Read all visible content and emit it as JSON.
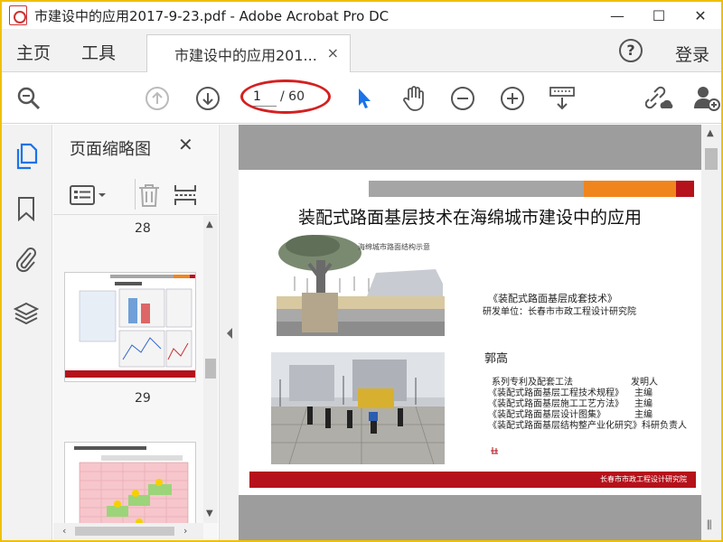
{
  "window": {
    "title": "市建设中的应用2017-9-23.pdf - Adobe Acrobat Pro DC",
    "controls": [
      "—",
      "☐",
      "✕"
    ]
  },
  "nav": {
    "home": "主页",
    "tools": "工具",
    "doc_tab": "市建设中的应用201...",
    "doc_tab_close": "×",
    "help": "?",
    "login": "登录"
  },
  "toolbar": {
    "page_current": "1",
    "page_total": "/ 60",
    "icons": [
      "search-icon",
      "page-up-icon",
      "page-down-icon",
      "select-arrow-icon",
      "hand-icon",
      "zoom-out-icon",
      "zoom-in-icon",
      "keyboard-scroll-icon",
      "link-cloud-icon",
      "add-user-icon"
    ]
  },
  "sidebar": {
    "icons": [
      "page-thumbnails-icon",
      "bookmark-icon",
      "attachment-icon",
      "layers-icon"
    ]
  },
  "thumbnails": {
    "title": "页面缩略图",
    "close": "✕",
    "pages": [
      {
        "label": "28"
      },
      {
        "label": "29"
      }
    ]
  },
  "slide": {
    "title": "装配式路面基层技术在海绵城市建设中的应用",
    "book": "《装配式路面基层成套技术》",
    "unit": "研发单位：长春市市政工程设计研究院",
    "author": "郭高",
    "lines": [
      "系列专利及配套工法",
      "《装配式路面基层工程技术规程》",
      "《装配式路面基层施工工艺方法》",
      "《装配式路面基层设计图集》",
      "《装配式路面基层结构整产业化研究》科研负责人"
    ],
    "roles": [
      "发明人",
      "主编",
      "主编",
      "主编"
    ],
    "footer": "长春市市政工程设计研究院",
    "image_caption": "海绵城市路面结构示意"
  },
  "colors": {
    "accent_red": "#b5121b",
    "accent_orange": "#f0851d",
    "accent_gray": "#a5a5a5",
    "select_blue": "#1a73e8",
    "border_yellow": "#f0c000"
  }
}
